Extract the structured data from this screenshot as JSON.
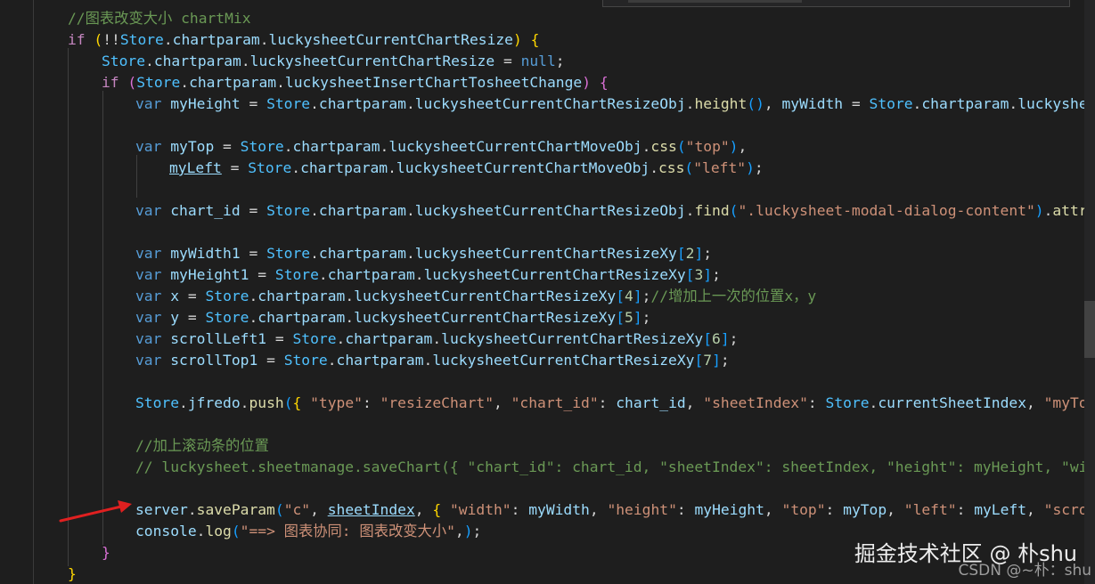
{
  "code_lines": [
    {
      "tokens": [
        {
          "c": "cm",
          "t": "//图表改变大小 chartMix"
        }
      ]
    },
    {
      "tokens": [
        {
          "c": "ctl",
          "t": "if"
        },
        {
          "c": "",
          "t": " "
        },
        {
          "c": "p1",
          "t": "("
        },
        {
          "c": "",
          "t": "!!"
        },
        {
          "c": "gl",
          "t": "Store"
        },
        {
          "c": "",
          "t": "."
        },
        {
          "c": "id",
          "t": "chartparam"
        },
        {
          "c": "",
          "t": "."
        },
        {
          "c": "id",
          "t": "luckysheetCurrentChartResize"
        },
        {
          "c": "p1",
          "t": ")"
        },
        {
          "c": "",
          "t": " "
        },
        {
          "c": "p1",
          "t": "{"
        }
      ]
    },
    {
      "tokens": [
        {
          "c": "gl",
          "t": "Store"
        },
        {
          "c": "",
          "t": "."
        },
        {
          "c": "id",
          "t": "chartparam"
        },
        {
          "c": "",
          "t": "."
        },
        {
          "c": "id",
          "t": "luckysheetCurrentChartResize"
        },
        {
          "c": "",
          "t": " = "
        },
        {
          "c": "kw",
          "t": "null"
        },
        {
          "c": "",
          "t": ";"
        }
      ]
    },
    {
      "tokens": [
        {
          "c": "ctl",
          "t": "if"
        },
        {
          "c": "",
          "t": " "
        },
        {
          "c": "p2",
          "t": "("
        },
        {
          "c": "gl",
          "t": "Store"
        },
        {
          "c": "",
          "t": "."
        },
        {
          "c": "id",
          "t": "chartparam"
        },
        {
          "c": "",
          "t": "."
        },
        {
          "c": "id",
          "t": "luckysheetInsertChartTosheetChange"
        },
        {
          "c": "p2",
          "t": ")"
        },
        {
          "c": "",
          "t": " "
        },
        {
          "c": "p2",
          "t": "{"
        }
      ]
    },
    {
      "tokens": [
        {
          "c": "kw",
          "t": "var"
        },
        {
          "c": "",
          "t": " "
        },
        {
          "c": "id",
          "t": "myHeight"
        },
        {
          "c": "",
          "t": " = "
        },
        {
          "c": "gl",
          "t": "Store"
        },
        {
          "c": "",
          "t": "."
        },
        {
          "c": "id",
          "t": "chartparam"
        },
        {
          "c": "",
          "t": "."
        },
        {
          "c": "id",
          "t": "luckysheetCurrentChartResizeObj"
        },
        {
          "c": "",
          "t": "."
        },
        {
          "c": "fn",
          "t": "height"
        },
        {
          "c": "p3",
          "t": "()"
        },
        {
          "c": "",
          "t": ", "
        },
        {
          "c": "id",
          "t": "myWidth"
        },
        {
          "c": "",
          "t": " = "
        },
        {
          "c": "gl",
          "t": "Store"
        },
        {
          "c": "",
          "t": "."
        },
        {
          "c": "id",
          "t": "chartparam"
        },
        {
          "c": "",
          "t": "."
        },
        {
          "c": "id",
          "t": "luckysheetCurrentChartResizeObj"
        }
      ]
    },
    {
      "tokens": []
    },
    {
      "tokens": [
        {
          "c": "kw",
          "t": "var"
        },
        {
          "c": "",
          "t": " "
        },
        {
          "c": "id",
          "t": "myTop"
        },
        {
          "c": "",
          "t": " = "
        },
        {
          "c": "gl",
          "t": "Store"
        },
        {
          "c": "",
          "t": "."
        },
        {
          "c": "id",
          "t": "chartparam"
        },
        {
          "c": "",
          "t": "."
        },
        {
          "c": "id",
          "t": "luckysheetCurrentChartMoveObj"
        },
        {
          "c": "",
          "t": "."
        },
        {
          "c": "fn",
          "t": "css"
        },
        {
          "c": "p3",
          "t": "("
        },
        {
          "c": "str",
          "t": "\"top\""
        },
        {
          "c": "p3",
          "t": ")"
        },
        {
          "c": "",
          "t": ","
        }
      ]
    },
    {
      "tokens": [
        {
          "c": "id ul",
          "t": "myLeft"
        },
        {
          "c": "",
          "t": " = "
        },
        {
          "c": "gl",
          "t": "Store"
        },
        {
          "c": "",
          "t": "."
        },
        {
          "c": "id",
          "t": "chartparam"
        },
        {
          "c": "",
          "t": "."
        },
        {
          "c": "id",
          "t": "luckysheetCurrentChartMoveObj"
        },
        {
          "c": "",
          "t": "."
        },
        {
          "c": "fn",
          "t": "css"
        },
        {
          "c": "p3",
          "t": "("
        },
        {
          "c": "str",
          "t": "\"left\""
        },
        {
          "c": "p3",
          "t": ")"
        },
        {
          "c": "",
          "t": ";"
        }
      ]
    },
    {
      "tokens": []
    },
    {
      "tokens": [
        {
          "c": "kw",
          "t": "var"
        },
        {
          "c": "",
          "t": " "
        },
        {
          "c": "id",
          "t": "chart_id"
        },
        {
          "c": "",
          "t": " = "
        },
        {
          "c": "gl",
          "t": "Store"
        },
        {
          "c": "",
          "t": "."
        },
        {
          "c": "id",
          "t": "chartparam"
        },
        {
          "c": "",
          "t": "."
        },
        {
          "c": "id",
          "t": "luckysheetCurrentChartResizeObj"
        },
        {
          "c": "",
          "t": "."
        },
        {
          "c": "fn",
          "t": "find"
        },
        {
          "c": "p3",
          "t": "("
        },
        {
          "c": "str",
          "t": "\".luckysheet-modal-dialog-content\""
        },
        {
          "c": "p3",
          "t": ")"
        },
        {
          "c": "",
          "t": "."
        },
        {
          "c": "fn",
          "t": "attr"
        },
        {
          "c": "p3",
          "t": "("
        },
        {
          "c": "str",
          "t": "\""
        }
      ]
    },
    {
      "tokens": []
    },
    {
      "tokens": [
        {
          "c": "kw",
          "t": "var"
        },
        {
          "c": "",
          "t": " "
        },
        {
          "c": "id",
          "t": "myWidth1"
        },
        {
          "c": "",
          "t": " = "
        },
        {
          "c": "gl",
          "t": "Store"
        },
        {
          "c": "",
          "t": "."
        },
        {
          "c": "id",
          "t": "chartparam"
        },
        {
          "c": "",
          "t": "."
        },
        {
          "c": "id",
          "t": "luckysheetCurrentChartResizeXy"
        },
        {
          "c": "p3",
          "t": "["
        },
        {
          "c": "num",
          "t": "2"
        },
        {
          "c": "p3",
          "t": "]"
        },
        {
          "c": "",
          "t": ";"
        }
      ]
    },
    {
      "tokens": [
        {
          "c": "kw",
          "t": "var"
        },
        {
          "c": "",
          "t": " "
        },
        {
          "c": "id",
          "t": "myHeight1"
        },
        {
          "c": "",
          "t": " = "
        },
        {
          "c": "gl",
          "t": "Store"
        },
        {
          "c": "",
          "t": "."
        },
        {
          "c": "id",
          "t": "chartparam"
        },
        {
          "c": "",
          "t": "."
        },
        {
          "c": "id",
          "t": "luckysheetCurrentChartResizeXy"
        },
        {
          "c": "p3",
          "t": "["
        },
        {
          "c": "num",
          "t": "3"
        },
        {
          "c": "p3",
          "t": "]"
        },
        {
          "c": "",
          "t": ";"
        }
      ]
    },
    {
      "tokens": [
        {
          "c": "kw",
          "t": "var"
        },
        {
          "c": "",
          "t": " "
        },
        {
          "c": "id",
          "t": "x"
        },
        {
          "c": "",
          "t": " = "
        },
        {
          "c": "gl",
          "t": "Store"
        },
        {
          "c": "",
          "t": "."
        },
        {
          "c": "id",
          "t": "chartparam"
        },
        {
          "c": "",
          "t": "."
        },
        {
          "c": "id",
          "t": "luckysheetCurrentChartResizeXy"
        },
        {
          "c": "p3",
          "t": "["
        },
        {
          "c": "num",
          "t": "4"
        },
        {
          "c": "p3",
          "t": "]"
        },
        {
          "c": "",
          "t": ";"
        },
        {
          "c": "cm",
          "t": "//增加上一次的位置x，y"
        }
      ]
    },
    {
      "tokens": [
        {
          "c": "kw",
          "t": "var"
        },
        {
          "c": "",
          "t": " "
        },
        {
          "c": "id",
          "t": "y"
        },
        {
          "c": "",
          "t": " = "
        },
        {
          "c": "gl",
          "t": "Store"
        },
        {
          "c": "",
          "t": "."
        },
        {
          "c": "id",
          "t": "chartparam"
        },
        {
          "c": "",
          "t": "."
        },
        {
          "c": "id",
          "t": "luckysheetCurrentChartResizeXy"
        },
        {
          "c": "p3",
          "t": "["
        },
        {
          "c": "num",
          "t": "5"
        },
        {
          "c": "p3",
          "t": "]"
        },
        {
          "c": "",
          "t": ";"
        }
      ]
    },
    {
      "tokens": [
        {
          "c": "kw",
          "t": "var"
        },
        {
          "c": "",
          "t": " "
        },
        {
          "c": "id",
          "t": "scrollLeft1"
        },
        {
          "c": "",
          "t": " = "
        },
        {
          "c": "gl",
          "t": "Store"
        },
        {
          "c": "",
          "t": "."
        },
        {
          "c": "id",
          "t": "chartparam"
        },
        {
          "c": "",
          "t": "."
        },
        {
          "c": "id",
          "t": "luckysheetCurrentChartResizeXy"
        },
        {
          "c": "p3",
          "t": "["
        },
        {
          "c": "num",
          "t": "6"
        },
        {
          "c": "p3",
          "t": "]"
        },
        {
          "c": "",
          "t": ";"
        }
      ]
    },
    {
      "tokens": [
        {
          "c": "kw",
          "t": "var"
        },
        {
          "c": "",
          "t": " "
        },
        {
          "c": "id",
          "t": "scrollTop1"
        },
        {
          "c": "",
          "t": " = "
        },
        {
          "c": "gl",
          "t": "Store"
        },
        {
          "c": "",
          "t": "."
        },
        {
          "c": "id",
          "t": "chartparam"
        },
        {
          "c": "",
          "t": "."
        },
        {
          "c": "id",
          "t": "luckysheetCurrentChartResizeXy"
        },
        {
          "c": "p3",
          "t": "["
        },
        {
          "c": "num",
          "t": "7"
        },
        {
          "c": "p3",
          "t": "]"
        },
        {
          "c": "",
          "t": ";"
        }
      ]
    },
    {
      "tokens": []
    },
    {
      "tokens": [
        {
          "c": "gl",
          "t": "Store"
        },
        {
          "c": "",
          "t": "."
        },
        {
          "c": "id",
          "t": "jfredo"
        },
        {
          "c": "",
          "t": "."
        },
        {
          "c": "fn",
          "t": "push"
        },
        {
          "c": "p3",
          "t": "("
        },
        {
          "c": "p1",
          "t": "{"
        },
        {
          "c": "",
          "t": " "
        },
        {
          "c": "str",
          "t": "\"type\""
        },
        {
          "c": "",
          "t": ": "
        },
        {
          "c": "str",
          "t": "\"resizeChart\""
        },
        {
          "c": "",
          "t": ", "
        },
        {
          "c": "str",
          "t": "\"chart_id\""
        },
        {
          "c": "",
          "t": ": "
        },
        {
          "c": "id",
          "t": "chart_id"
        },
        {
          "c": "",
          "t": ", "
        },
        {
          "c": "str",
          "t": "\"sheetIndex\""
        },
        {
          "c": "",
          "t": ": "
        },
        {
          "c": "gl",
          "t": "Store"
        },
        {
          "c": "",
          "t": "."
        },
        {
          "c": "id",
          "t": "currentSheetIndex"
        },
        {
          "c": "",
          "t": ", "
        },
        {
          "c": "str",
          "t": "\"myTop\""
        }
      ]
    },
    {
      "tokens": []
    },
    {
      "tokens": [
        {
          "c": "cm",
          "t": "//加上滚动条的位置"
        }
      ]
    },
    {
      "tokens": [
        {
          "c": "cm",
          "t": "// luckysheet.sheetmanage.saveChart({ \"chart_id\": chart_id, \"sheetIndex\": sheetIndex, \"height\": myHeight, \"widt"
        }
      ]
    },
    {
      "tokens": []
    },
    {
      "tokens": [
        {
          "c": "id",
          "t": "server"
        },
        {
          "c": "",
          "t": "."
        },
        {
          "c": "fn",
          "t": "saveParam"
        },
        {
          "c": "p3",
          "t": "("
        },
        {
          "c": "str",
          "t": "\"c\""
        },
        {
          "c": "",
          "t": ", "
        },
        {
          "c": "id ul",
          "t": "sheetIndex"
        },
        {
          "c": "",
          "t": ", "
        },
        {
          "c": "p1",
          "t": "{"
        },
        {
          "c": "",
          "t": " "
        },
        {
          "c": "str",
          "t": "\"width\""
        },
        {
          "c": "",
          "t": ": "
        },
        {
          "c": "id",
          "t": "myWidth"
        },
        {
          "c": "",
          "t": ", "
        },
        {
          "c": "str",
          "t": "\"height\""
        },
        {
          "c": "",
          "t": ": "
        },
        {
          "c": "id",
          "t": "myHeight"
        },
        {
          "c": "",
          "t": ", "
        },
        {
          "c": "str",
          "t": "\"top\""
        },
        {
          "c": "",
          "t": ": "
        },
        {
          "c": "id",
          "t": "myTop"
        },
        {
          "c": "",
          "t": ", "
        },
        {
          "c": "str",
          "t": "\"left\""
        },
        {
          "c": "",
          "t": ": "
        },
        {
          "c": "id",
          "t": "myLeft"
        },
        {
          "c": "",
          "t": ", "
        },
        {
          "c": "str",
          "t": "\"scroll"
        }
      ]
    },
    {
      "tokens": [
        {
          "c": "id",
          "t": "console"
        },
        {
          "c": "",
          "t": "."
        },
        {
          "c": "fn",
          "t": "log"
        },
        {
          "c": "p3",
          "t": "("
        },
        {
          "c": "str",
          "t": "\"==> 图表协同: 图表改变大小\""
        },
        {
          "c": "",
          "t": ","
        },
        {
          "c": "p3",
          "t": ")"
        },
        {
          "c": "",
          "t": ";"
        }
      ]
    },
    {
      "tokens": [
        {
          "c": "p2",
          "t": "}"
        }
      ]
    },
    {
      "tokens": [
        {
          "c": "p1",
          "t": "}"
        }
      ]
    }
  ],
  "watermark": "掘金技术社区 @ 朴shu",
  "csdn_watermark": "CSDN @~朴：shu"
}
